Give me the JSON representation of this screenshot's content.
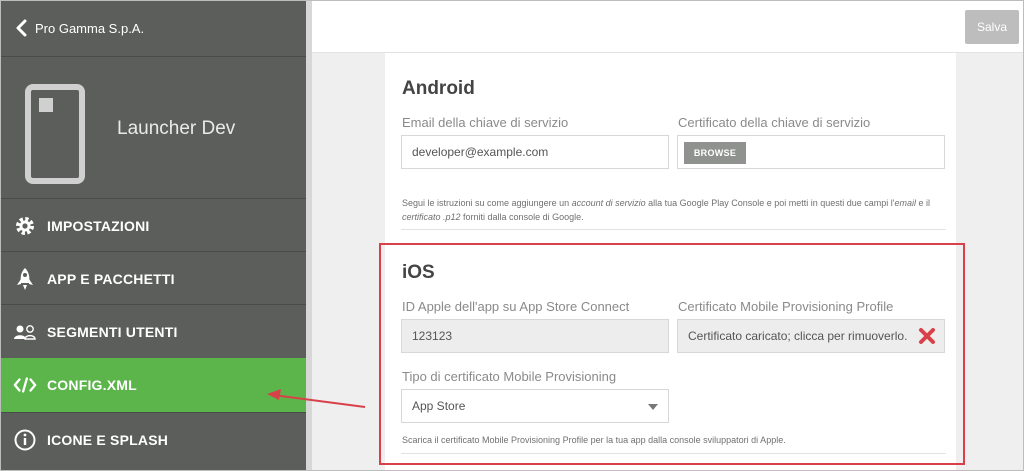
{
  "sidebar": {
    "back_label": "Pro Gamma S.p.A.",
    "app_name": "Launcher Dev",
    "items": [
      {
        "label": "IMPOSTAZIONI",
        "icon": "gear-icon"
      },
      {
        "label": "APP E PACCHETTI",
        "icon": "rocket-icon"
      },
      {
        "label": "SEGMENTI UTENTI",
        "icon": "users-icon"
      },
      {
        "label": "CONFIG.XML",
        "icon": "code-icon",
        "active": true
      },
      {
        "label": "ICONE E SPLASH",
        "icon": "info-icon"
      }
    ]
  },
  "toolbar": {
    "save_label": "Salva"
  },
  "android": {
    "title": "Android",
    "email_label": "Email della chiave di servizio",
    "email_value": "developer@example.com",
    "cert_label": "Certificato della chiave di servizio",
    "browse_label": "BROWSE",
    "help_1": "Segui le istruzioni su come aggiungere un ",
    "help_em1": "account di servizio",
    "help_2": " alla tua Google Play Console e poi metti in questi due campi l'",
    "help_em2": "email",
    "help_3": " e il ",
    "help_em3": "certificato .p12",
    "help_4": " forniti dalla console di Google."
  },
  "ios": {
    "title": "iOS",
    "appid_label": "ID Apple dell'app su App Store Connect",
    "appid_value": "123123",
    "profile_label": "Certificato Mobile Provisioning Profile",
    "profile_value": "Certificato caricato; clicca per rimuoverlo.",
    "type_label": "Tipo di certificato Mobile Provisioning",
    "type_value": "App Store",
    "help": "Scarica il certificato Mobile Provisioning Profile per la tua app dalla console sviluppatori di Apple."
  },
  "colors": {
    "active_menu": "#5cb54b",
    "sidebar": "#5b5e5b",
    "annotation": "#d9414a",
    "remove_x": "#d9414a"
  }
}
